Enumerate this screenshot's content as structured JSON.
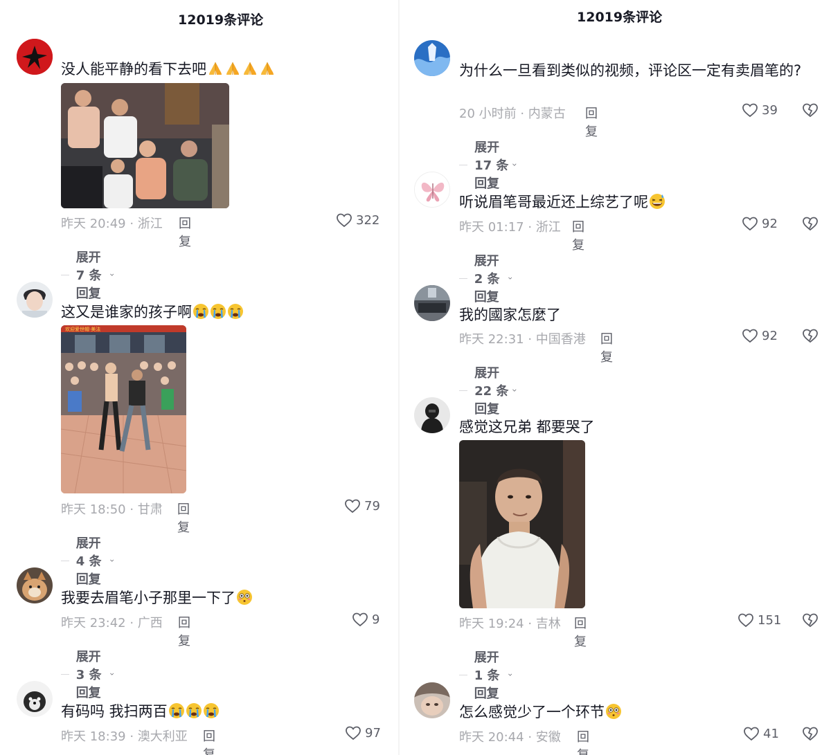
{
  "left": {
    "header_title": "12019条评论",
    "comments": [
      {
        "text": "没人能平静的看下去吧",
        "emoji": [
          "pray",
          "pray",
          "pray",
          "pray"
        ],
        "time": "昨天 20:49 · 浙江",
        "reply": "回复",
        "likes": "322",
        "expand": "展开 7 条回复"
      },
      {
        "text": "这又是谁家的孩子啊",
        "emoji": [
          "cry",
          "cry",
          "cry"
        ],
        "time": "昨天 18:50 · 甘肃",
        "reply": "回复",
        "likes": "79",
        "expand": "展开 4 条回复",
        "photo_caption": "欢迎爱世帽·美法"
      },
      {
        "text": "我要去眉笔小子那里一下了",
        "emoji": [
          "flushed"
        ],
        "time": "昨天 23:42 · 广西",
        "reply": "回复",
        "likes": "9",
        "expand": "展开 3 条回复"
      },
      {
        "text": "有码吗 我扫两百",
        "emoji": [
          "cry",
          "cry",
          "cry"
        ],
        "time": "昨天 18:39 · 澳大利亚",
        "reply": "回复",
        "likes": "97"
      }
    ]
  },
  "right": {
    "header_title": "12019条评论",
    "comments": [
      {
        "text": "为什么一旦看到类似的视频，评论区一定有卖眉笔的?",
        "time": "20 小时前 · 内蒙古",
        "reply": "回复",
        "likes": "39",
        "expand": "展开 17 条回复"
      },
      {
        "text": "听说眉笔哥最近还上综艺了呢",
        "emoji": [
          "sweat-smile"
        ],
        "time": "昨天 01:17 · 浙江",
        "reply": "回复",
        "likes": "92",
        "expand": "展开 2 条回复"
      },
      {
        "text": "我的國家怎麼了",
        "time": "昨天 22:31 · 中国香港",
        "reply": "回复",
        "likes": "92",
        "expand": "展开 22 条回复"
      },
      {
        "text": "感觉这兄弟 都要哭了",
        "time": "昨天 19:24 · 吉林",
        "reply": "回复",
        "likes": "151",
        "expand": "展开 1 条回复"
      },
      {
        "text": "怎么感觉少了一个环节",
        "emoji": [
          "flushed"
        ],
        "time": "昨天 20:44 · 安徽",
        "reply": "回复",
        "likes": "41"
      }
    ]
  },
  "icons": {
    "like": "heart-outline-icon",
    "dislike": "broken-heart-icon",
    "expand": "chevron-down-icon"
  },
  "colors": {
    "text": "#161823",
    "meta": "#a7a8ad",
    "secondary": "#5c5e67",
    "emoji_yellow": "#f7c531",
    "tear_blue": "#4aa3ea"
  }
}
